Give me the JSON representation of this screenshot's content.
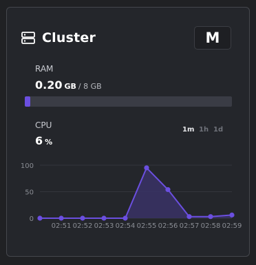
{
  "widget": {
    "title": "Cluster",
    "size_badge": "M",
    "accent_color": "#6b4fe0",
    "icon": "server-icon"
  },
  "ram": {
    "label": "RAM",
    "used": "0.20",
    "used_unit": "GB",
    "total": "/ 8 GB",
    "usage_fraction": 0.025
  },
  "cpu": {
    "label": "CPU",
    "value": "6",
    "unit": "%"
  },
  "time_ranges": [
    {
      "label": "1m",
      "active": true
    },
    {
      "label": "1h",
      "active": false
    },
    {
      "label": "1d",
      "active": false
    }
  ],
  "chart_data": {
    "type": "area",
    "x": [
      "02:51",
      "02:52",
      "02:53",
      "02:54",
      "02:55",
      "02:56",
      "02:57",
      "02:58",
      "02:59"
    ],
    "x_all": [
      "",
      "02:51",
      "02:52",
      "02:53",
      "02:54",
      "02:55",
      "02:56",
      "02:57",
      "02:58",
      "02:59"
    ],
    "values": [
      0,
      0,
      0,
      0,
      0,
      95,
      54,
      3,
      3,
      6
    ],
    "ylim": [
      0,
      100
    ],
    "y_ticks": [
      "100",
      "50",
      "0"
    ],
    "grid": true,
    "line_color": "#6b4fe0"
  }
}
